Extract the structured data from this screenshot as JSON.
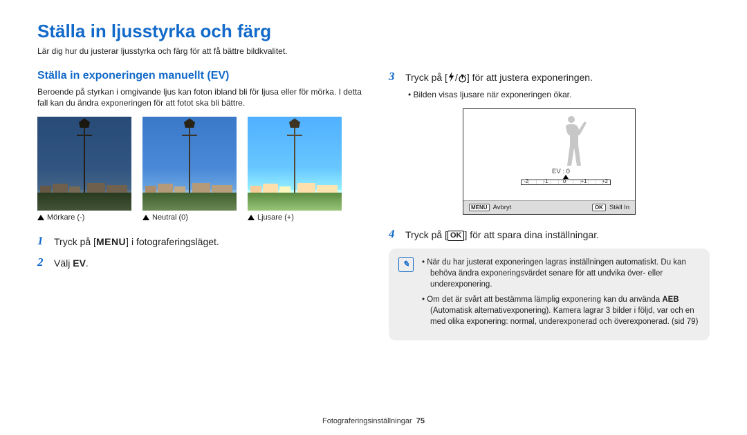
{
  "page": {
    "title": "Ställa in ljusstyrka och färg",
    "intro": "Lär dig hur du justerar ljusstyrka och färg för att få bättre bildkvalitet."
  },
  "left": {
    "section_title": "Ställa in exponeringen manuellt (EV)",
    "body": "Beroende på styrkan i omgivande ljus kan foton ibland bli för ljusa eller för mörka. I detta fall kan du ändra exponeringen för att fotot ska bli bättre.",
    "captions": [
      "Mörkare (-)",
      "Neutral (0)",
      "Ljusare (+)"
    ],
    "step1_pre": "Tryck på [",
    "step1_menu": "MENU",
    "step1_post": "] i fotograferingsläget.",
    "step2_pre": "Välj ",
    "step2_bold": "EV",
    "step2_post": "."
  },
  "right": {
    "step3_pre": "Tryck på [",
    "step3_sep": "/",
    "step3_post": "] för att justera exponeringen.",
    "step3_bullet": "Bilden visas ljusare när exponeringen ökar.",
    "screen": {
      "ev_label": "EV : 0",
      "ticks": [
        "-2",
        "-1",
        "0",
        "+1",
        "+2"
      ],
      "footer_left_btn": "MENU",
      "footer_left": "Avbryt",
      "footer_right_btn": "OK",
      "footer_right": "Ställ In"
    },
    "step4_pre": "Tryck på [",
    "step4_ok": "OK",
    "step4_post": "] för att spara dina inställningar.",
    "notes": {
      "n1a": "När du har justerat exponeringen lagras inställningen automatiskt. Du kan behöva ändra exponeringsvärdet senare för att undvika över- eller underexponering.",
      "n2_pre": "Om det är svårt att bestämma lämplig exponering kan du använ­da ",
      "n2_bold": "AEB",
      "n2_post": " (Automatisk alternativexponering). Kamera lagrar 3 bilder i följd, var och en med olika exponering: normal, underexponerad och överexponerad. (sid 79)"
    }
  },
  "footer": {
    "label": "Fotograferingsinställningar",
    "page": "75"
  }
}
